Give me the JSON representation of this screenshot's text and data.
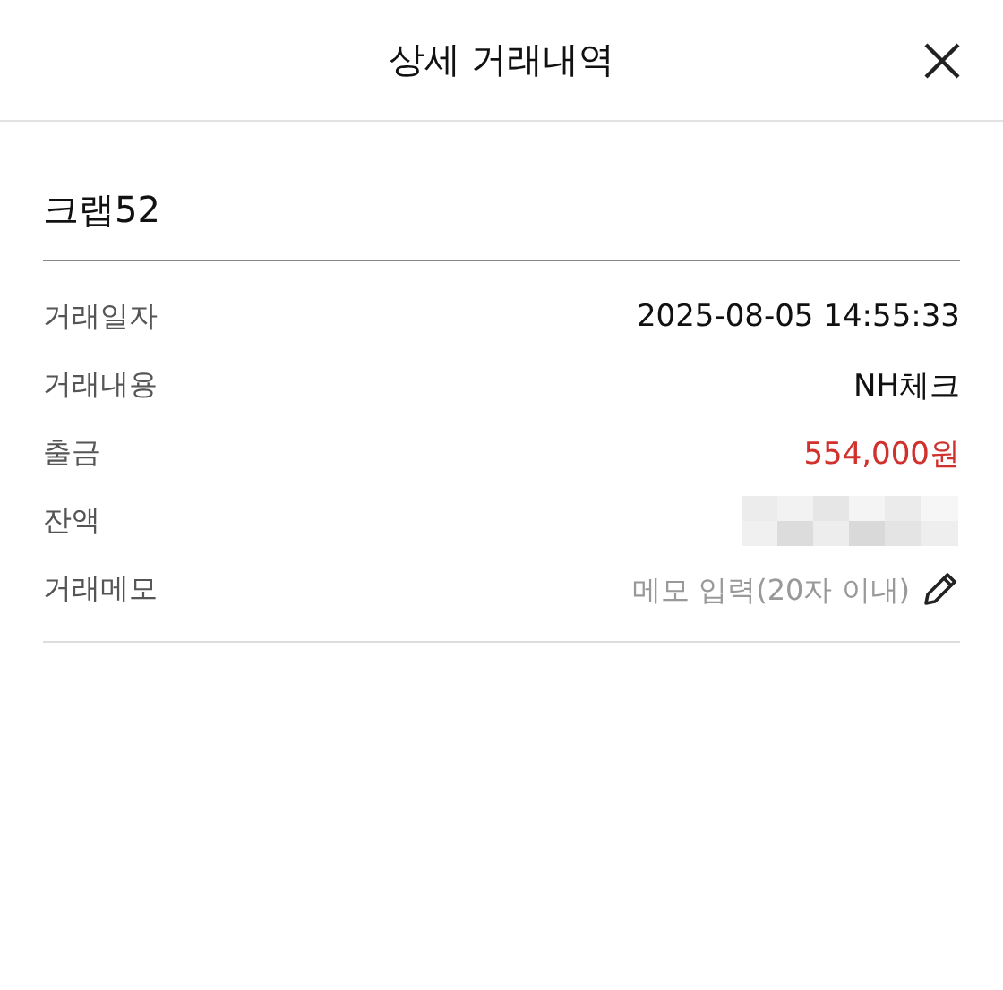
{
  "header": {
    "title": "상세 거래내역"
  },
  "merchant": "크랩52",
  "rows": [
    {
      "label": "거래일자",
      "kind": "text",
      "value": "2025-08-05 14:55:33"
    },
    {
      "label": "거래내용",
      "kind": "text",
      "value": "NH체크"
    },
    {
      "label": "출금",
      "kind": "withdrawal",
      "value": "554,000원"
    },
    {
      "label": "잔액",
      "kind": "redacted"
    },
    {
      "label": "거래메모",
      "kind": "memo",
      "placeholder": "메모 입력(20자 이내)"
    }
  ]
}
